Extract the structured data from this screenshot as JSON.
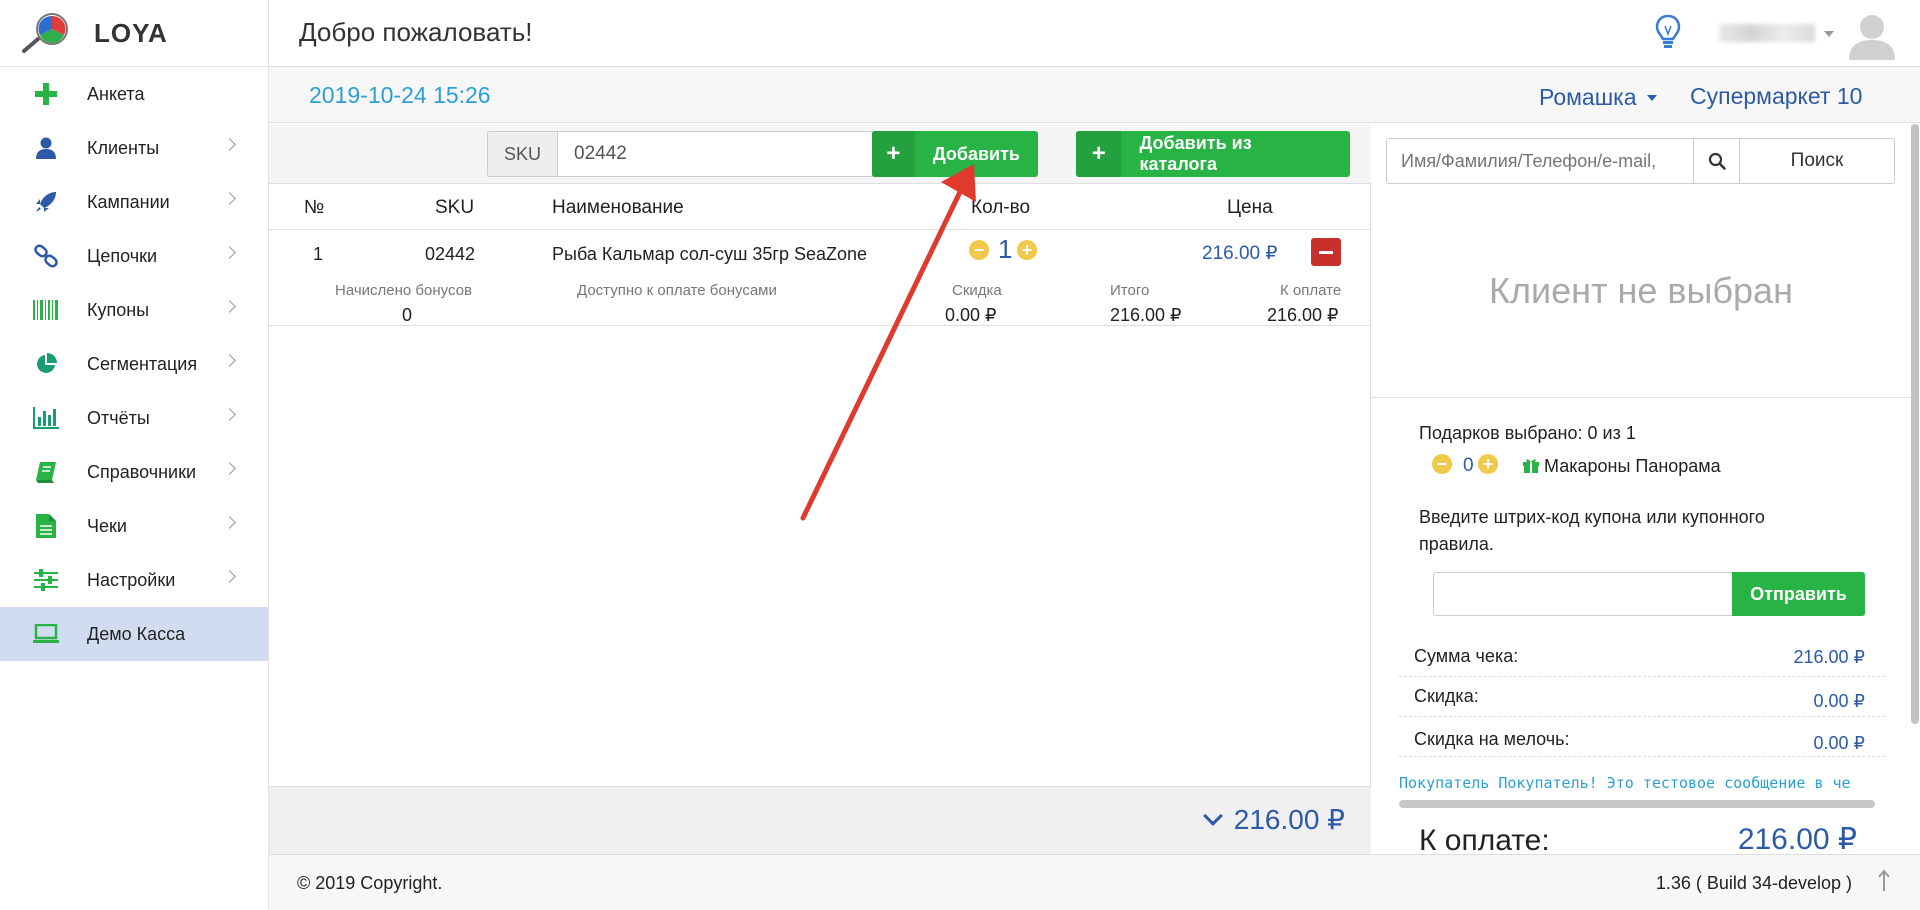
{
  "app": {
    "logo_text": "LOYA",
    "page_title": "Добро пожаловать!"
  },
  "sidebar": {
    "items": [
      {
        "label": "Анкета",
        "icon": "plus-icon",
        "color": "#28b345"
      },
      {
        "label": "Клиенты",
        "icon": "user-icon",
        "color": "#2d5aa8"
      },
      {
        "label": "Кампании",
        "icon": "rocket-icon",
        "color": "#2d5aa8"
      },
      {
        "label": "Цепочки",
        "icon": "link-icon",
        "color": "#2d5aa8"
      },
      {
        "label": "Купоны",
        "icon": "barcode-icon",
        "color": "#28b345"
      },
      {
        "label": "Сегментация",
        "icon": "pie-chart-icon",
        "color": "#1a9c72"
      },
      {
        "label": "Отчёты",
        "icon": "bar-chart-icon",
        "color": "#1a9c72"
      },
      {
        "label": "Справочники",
        "icon": "book-icon",
        "color": "#28b345"
      },
      {
        "label": "Чеки",
        "icon": "document-icon",
        "color": "#28b345"
      },
      {
        "label": "Настройки",
        "icon": "sliders-icon",
        "color": "#28b345"
      },
      {
        "label": "Демо Касса",
        "icon": "laptop-icon",
        "color": "#28b345"
      }
    ]
  },
  "subheader": {
    "datetime": "2019-10-24 15:26",
    "store": "Ромашка",
    "shop": "Супермаркет 10"
  },
  "toolbar": {
    "sku_label": "SKU",
    "sku_value": "02442",
    "add_label": "Добавить",
    "add_catalog_label": "Добавить из каталога",
    "plus": "+"
  },
  "table": {
    "headers": {
      "num": "№",
      "sku": "SKU",
      "name": "Наименование",
      "qty": "Кол-во",
      "price": "Цена"
    },
    "row": {
      "num": "1",
      "sku": "02442",
      "name": "Рыба Кальмар сол-суш 35гр SeaZone",
      "qty": "1",
      "price": "216.00 ₽",
      "bonus_label": "Начислено бонусов",
      "bonus_value": "0",
      "bonus_pay_label": "Доступно к оплате бонусами",
      "discount_label": "Скидка",
      "discount_value": "0.00 ₽",
      "total_label": "Итого",
      "total_value": "216.00 ₽",
      "topay_label": "К оплате",
      "topay_value": "216.00 ₽"
    }
  },
  "total": "216.00 ₽",
  "client": {
    "search_placeholder": "Имя/Фамилия/Телефон/e-mail,",
    "search_button": "Поиск",
    "no_client": "Клиент не выбран"
  },
  "gifts": {
    "selected_text": "Подарков выбрано: 0 из 1",
    "qty": "0",
    "gift_name": "Макароны Панорама"
  },
  "coupon": {
    "prompt_line1": "Введите штрих-код купона или купонного",
    "prompt_line2": "правила.",
    "submit_label": "Отправить"
  },
  "summary": {
    "sum_label": "Сумма чека:",
    "sum_value": "216.00 ₽",
    "discount_label": "Скидка:",
    "discount_value": "0.00 ₽",
    "change_discount_label": "Скидка на мелочь:",
    "change_discount_value": "0.00 ₽",
    "ticker": "Покупатель Покупатель! Это тестовое сообщение в че",
    "pay_label": "К оплате:",
    "pay_value": "216.00 ₽"
  },
  "footer": {
    "copyright": "© 2019 Copyright.",
    "version": "1.36 ( Build 34-develop )"
  },
  "colors": {
    "accent_blue": "#2d5aa8",
    "datetime_blue": "#2b9fd6",
    "green": "#28b345",
    "danger": "#c9302c",
    "active_nav": "#d2dcf0"
  }
}
